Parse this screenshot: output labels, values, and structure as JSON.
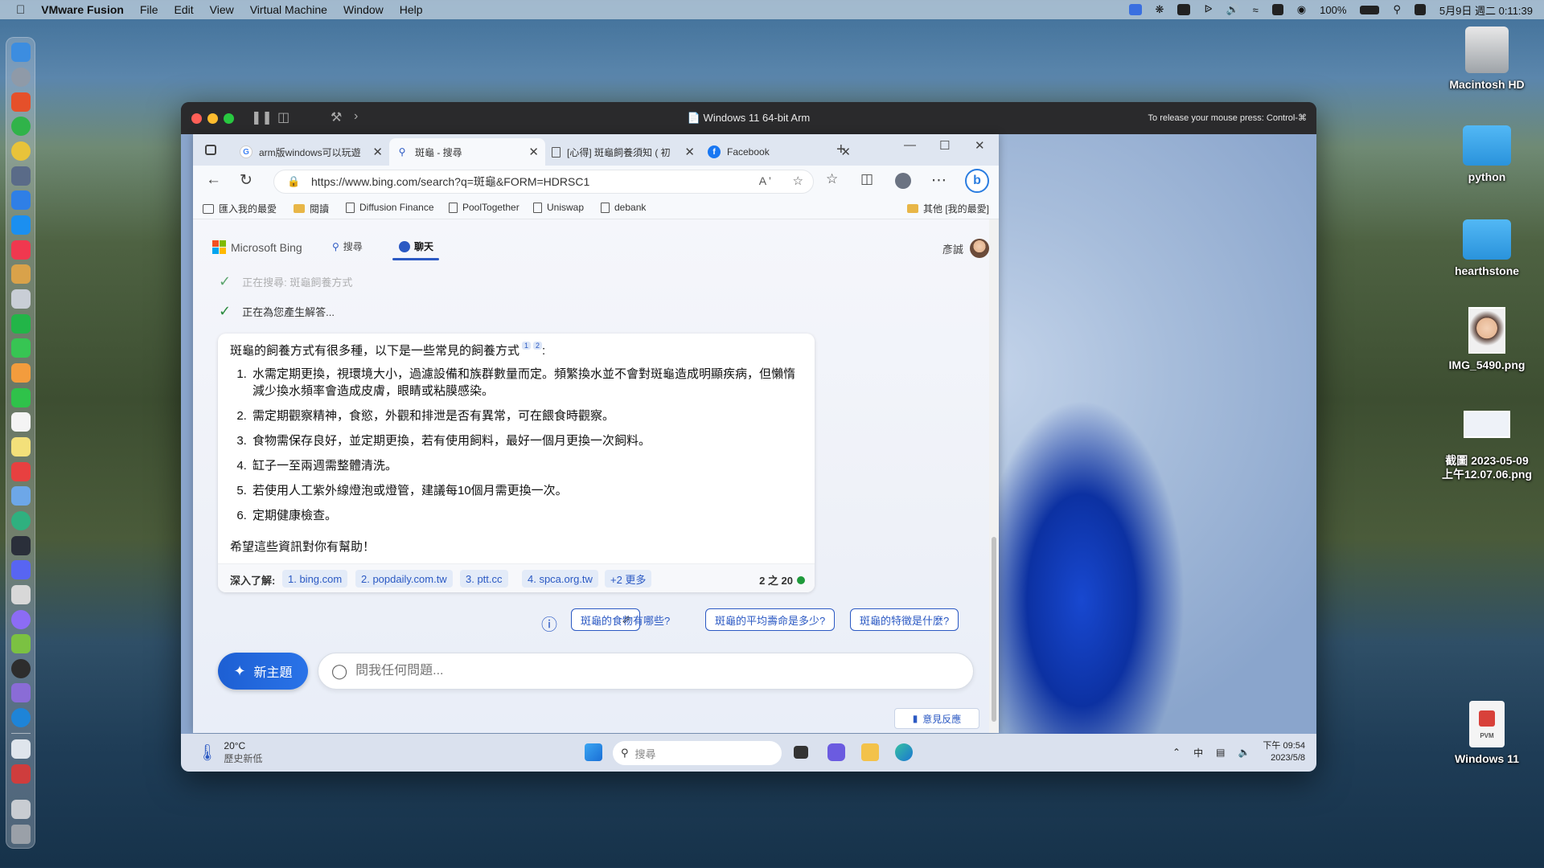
{
  "mac_menubar": {
    "app_name": "VMware Fusion",
    "menus": [
      "File",
      "Edit",
      "View",
      "Virtual Machine",
      "Window",
      "Help"
    ],
    "battery": "100%",
    "datetime": "5月9日 週二 0:11:39"
  },
  "desktop_icons": [
    {
      "label": "Macintosh HD",
      "icon": "hard-drive-icon"
    },
    {
      "label": "python",
      "icon": "folder-icon"
    },
    {
      "label": "hearthstone",
      "icon": "folder-icon"
    },
    {
      "label": "IMG_5490.png",
      "icon": "image-thumbnail-icon"
    },
    {
      "label": "截圖 2023-05-09\n上午12.07.06.png",
      "icon": "screenshot-thumbnail-icon"
    },
    {
      "label": "Windows 11",
      "icon": "vm-bundle-icon",
      "badge": "PVM"
    }
  ],
  "vm_window": {
    "title": "Windows 11 64-bit Arm",
    "hint": "To release your mouse press: Control-⌘"
  },
  "browser": {
    "tabs": [
      {
        "label": "arm版windows可以玩遊",
        "icon": "google-icon",
        "active": false
      },
      {
        "label": "斑龜 - 搜尋",
        "icon": "search-icon",
        "active": true
      },
      {
        "label": "[心得] 斑龜飼養須知 ( 初",
        "icon": "page-icon",
        "active": false
      },
      {
        "label": "Facebook",
        "icon": "facebook-icon",
        "active": false
      }
    ],
    "url": "https://www.bing.com/search?q=斑龜&FORM=HDRSC1",
    "bookmarks": [
      {
        "label": "匯入我的最愛",
        "icon": "import-icon"
      },
      {
        "label": "閱讀",
        "icon": "folder-icon"
      },
      {
        "label": "Diffusion Finance",
        "icon": "page-icon"
      },
      {
        "label": "PoolTogether",
        "icon": "page-icon"
      },
      {
        "label": "Uniswap",
        "icon": "page-icon"
      },
      {
        "label": "debank",
        "icon": "page-icon"
      }
    ],
    "other_favorites": "其他 [我的最愛]"
  },
  "bing": {
    "brand": "Microsoft Bing",
    "nav_search": "搜尋",
    "nav_chat": "聊天",
    "user_name": "彥誠",
    "step_searching": "正在搜尋: 斑龜飼養方式",
    "step_generating": "正在為您產生解答...",
    "answer_intro": "斑龜的飼養方式有很多種，以下是一些常見的飼養方式",
    "citations": [
      "1",
      "2"
    ],
    "answer_colon": ":",
    "answer_items": [
      "水需定期更換，視環境大小，過濾設備和族群數量而定。頻繁換水並不會對斑龜造成明顯疾病，但懶惰減少換水頻率會造成皮膚，眼睛或粘膜感染。",
      "需定期觀察精神，食慾，外觀和排泄是否有異常，可在餵食時觀察。",
      "食物需保存良好，並定期更換，若有使用飼料，最好一個月更換一次飼料。",
      "缸子一至兩週需整體清洗。",
      "若使用人工紫外線燈泡或燈管，建議每10個月需更換一次。",
      "定期健康檢查。"
    ],
    "answer_outro": "希望這些資訊對你有幫助！",
    "learn_more_label": "深入了解:",
    "sources": [
      "1. bing.com",
      "2. popdaily.com.tw",
      "3. ptt.cc",
      "4. spca.org.tw",
      "+2 更多"
    ],
    "page_counter": "2 之 20",
    "suggestions": [
      "斑龜的食物有哪些?",
      "斑龜的平均壽命是多少?",
      "斑龜的特徵是什麼?"
    ],
    "new_topic": "新主題",
    "ask_placeholder": "問我任何問題...",
    "feedback": "意見反應"
  },
  "win_taskbar": {
    "temp": "20°C",
    "weather_news": "歷史新低",
    "search_placeholder": "搜尋",
    "ime": "中",
    "time": "下午 09:54",
    "date": "2023/5/8"
  }
}
